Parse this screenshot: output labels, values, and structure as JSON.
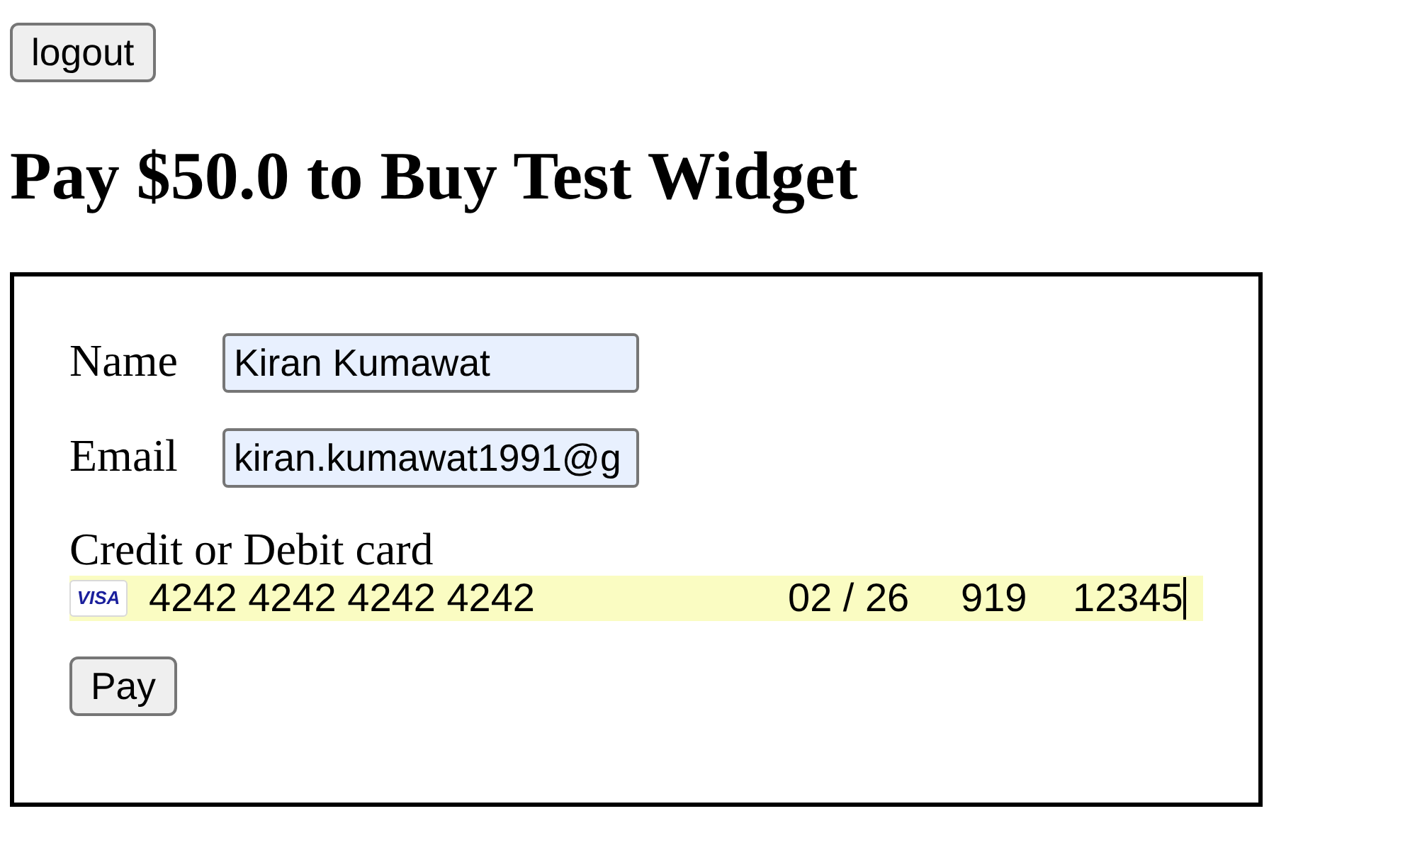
{
  "logout_button": "logout",
  "heading": "Pay $50.0 to Buy Test Widget",
  "payment_form": {
    "fields": [
      {
        "label": "Name",
        "value": "Kiran Kumawat",
        "autofilled": true
      },
      {
        "label": "Email",
        "value": "kiran.kumawat1991@g",
        "autofilled": true
      }
    ],
    "card": {
      "label": "Credit or Debit card",
      "brand": "VISA",
      "autofilled": true,
      "parts": [
        {
          "kind": "number",
          "value": "4242 4242 4242 4242",
          "focused": false
        },
        {
          "kind": "expiry",
          "value": "02 / 26",
          "focused": false
        },
        {
          "kind": "cvc",
          "value": "919",
          "focused": false
        },
        {
          "kind": "postal",
          "value": "12345",
          "focused": true
        }
      ]
    },
    "submit_button": "Pay"
  }
}
